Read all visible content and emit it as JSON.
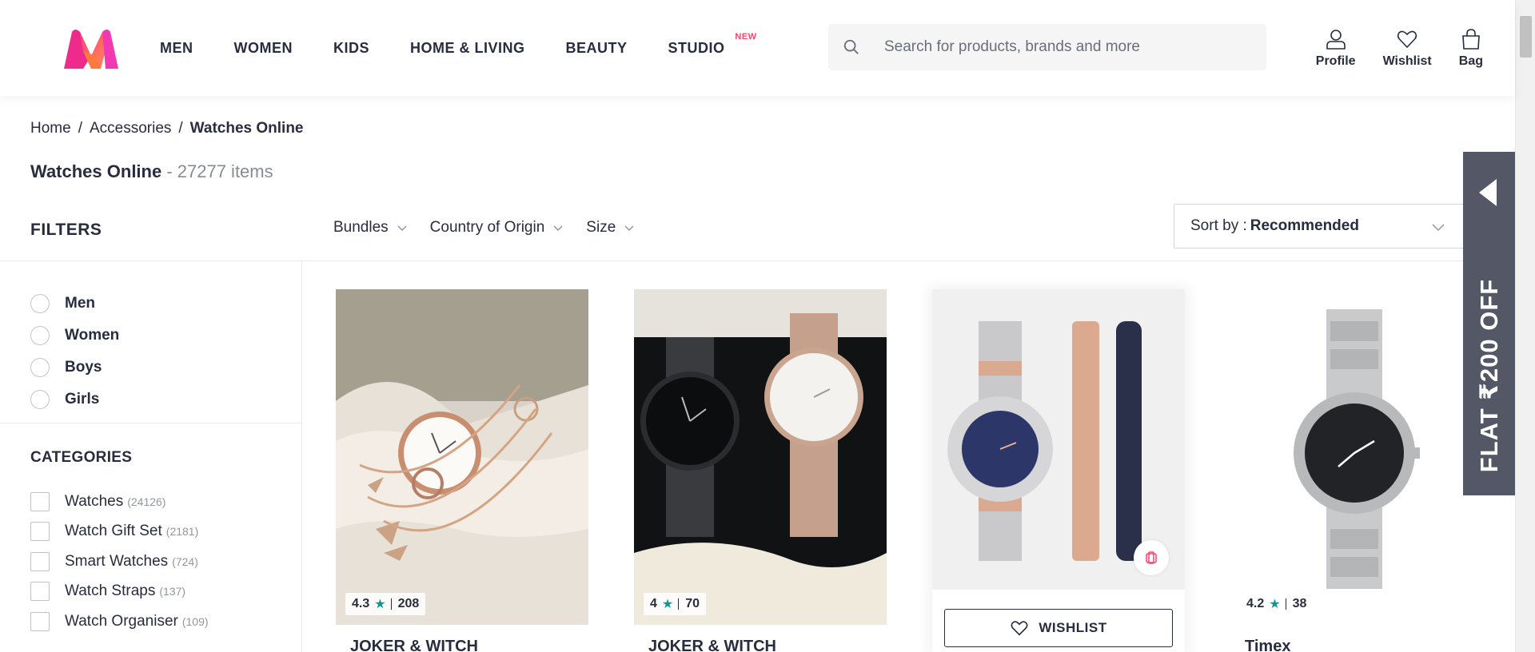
{
  "nav": {
    "items": [
      {
        "label": "MEN"
      },
      {
        "label": "WOMEN"
      },
      {
        "label": "KIDS"
      },
      {
        "label": "HOME & LIVING"
      },
      {
        "label": "BEAUTY"
      },
      {
        "label": "STUDIO",
        "badge": "NEW"
      }
    ]
  },
  "search": {
    "placeholder": "Search for products, brands and more"
  },
  "actions": {
    "profile": "Profile",
    "wishlist": "Wishlist",
    "bag": "Bag"
  },
  "breadcrumb": {
    "home": "Home",
    "accessories": "Accessories",
    "current": "Watches Online"
  },
  "title": {
    "text": "Watches Online",
    "count": " - 27277 items"
  },
  "filters": {
    "heading": "FILTERS",
    "bar": [
      {
        "label": "Bundles"
      },
      {
        "label": "Country of Origin"
      },
      {
        "label": "Size"
      }
    ],
    "sort_prefix": "Sort by :",
    "sort_value": "Recommended",
    "gender": [
      {
        "label": "Men"
      },
      {
        "label": "Women"
      },
      {
        "label": "Boys"
      },
      {
        "label": "Girls"
      }
    ],
    "categories_heading": "CATEGORIES",
    "categories": [
      {
        "label": "Watches",
        "count": "(24126)"
      },
      {
        "label": "Watch Gift Set",
        "count": "(2181)"
      },
      {
        "label": "Smart Watches",
        "count": "(724)"
      },
      {
        "label": "Watch Straps",
        "count": "(137)"
      },
      {
        "label": "Watch Organiser",
        "count": "(109)"
      }
    ]
  },
  "products": [
    {
      "brand": "JOKER & WITCH",
      "rating": "4.3",
      "reviews": "208"
    },
    {
      "brand": "JOKER & WITCH",
      "rating": "4",
      "reviews": "70"
    },
    {
      "wishlist_label": "WISHLIST"
    },
    {
      "brand": "Timex",
      "rating": "4.2",
      "reviews": "38"
    }
  ],
  "promo": {
    "text": "FLAT ₹200 OFF"
  },
  "colors": {
    "accent": "#ff3f6c",
    "text": "#282c3f",
    "star": "#14958f",
    "promo_bg": "#535766"
  }
}
